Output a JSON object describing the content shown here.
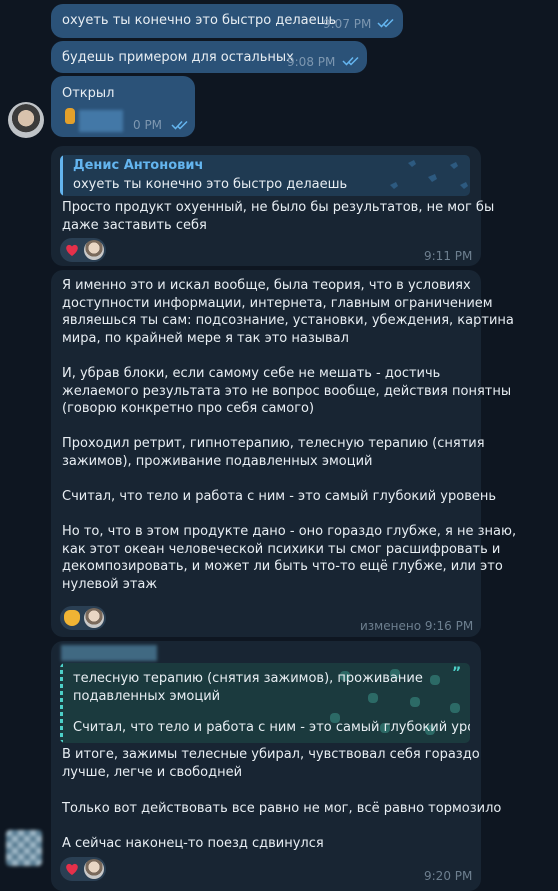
{
  "colors": {
    "bg": "#0e1621",
    "outgoing": "#2b5278",
    "incoming": "#182533",
    "accent": "#64b5ef",
    "meta": "#7d97b0"
  },
  "messages": [
    {
      "text": "охуеть ты конечно это быстро делаешь",
      "time": "9:07 PM",
      "status": "read"
    },
    {
      "text": "будешь примером для остальных",
      "time": "9:08 PM",
      "status": "read"
    },
    {
      "text": "Открыл",
      "time": "0 PM",
      "status": "read"
    }
  ],
  "reply1": {
    "quote_author": "Денис Антонович",
    "quote_text": "охуеть ты конечно это быстро делаешь",
    "lines": [
      "Просто продукт охуенный, не было бы результатов, не мог бы",
      "даже заставить себя"
    ],
    "time": "9:11 PM",
    "reaction": "heart"
  },
  "long_msg": {
    "lines": [
      "Я именно это и искал вообще, была теория, что в условиях",
      "доступности информации, интернета, главным ограничением",
      "являешься ты сам: подсознание, установки, убеждения, картина",
      "мира, по крайней мере я так это называл",
      "",
      "И, убрав блоки, если самому себе не мешать - достичь",
      "желаемого результата это не вопрос вообще, действия понятны",
      "(говорю конкретно про себя самого)",
      "",
      "Проходил ретрит, гипнотерапию, телесную терапию (снятия",
      "зажимов), проживание подавленных эмоций",
      "",
      "Считал, что тело и работа с ним - это самый глубокий уровень",
      "",
      "Но то, что в этом продукте дано - оно гораздо глубже, я не знаю,",
      "как этот океан человеческой психики ты смог расшифровать и",
      "декомпозировать, и может ли быть что-то ещё глубже, или это",
      "нулевой этаж"
    ],
    "time": "изменено 9:16 PM",
    "reaction": "handshake"
  },
  "last_msg": {
    "quote_lines": [
      "телесную терапию (снятия зажимов), проживание",
      "подавленных эмоций",
      "",
      "Считал, что тело и работа с ним - это самый глубокий уровень"
    ],
    "lines": [
      "В итоге, зажимы телесные убирал, чувствовал себя гораздо",
      "лучше, легче и свободней",
      "",
      "Только вот действовать все равно не мог, всё равно тормозило",
      "",
      "А сейчас наконец-то поезд сдвинулся"
    ],
    "time": "9:20 PM",
    "reaction": "heart"
  }
}
